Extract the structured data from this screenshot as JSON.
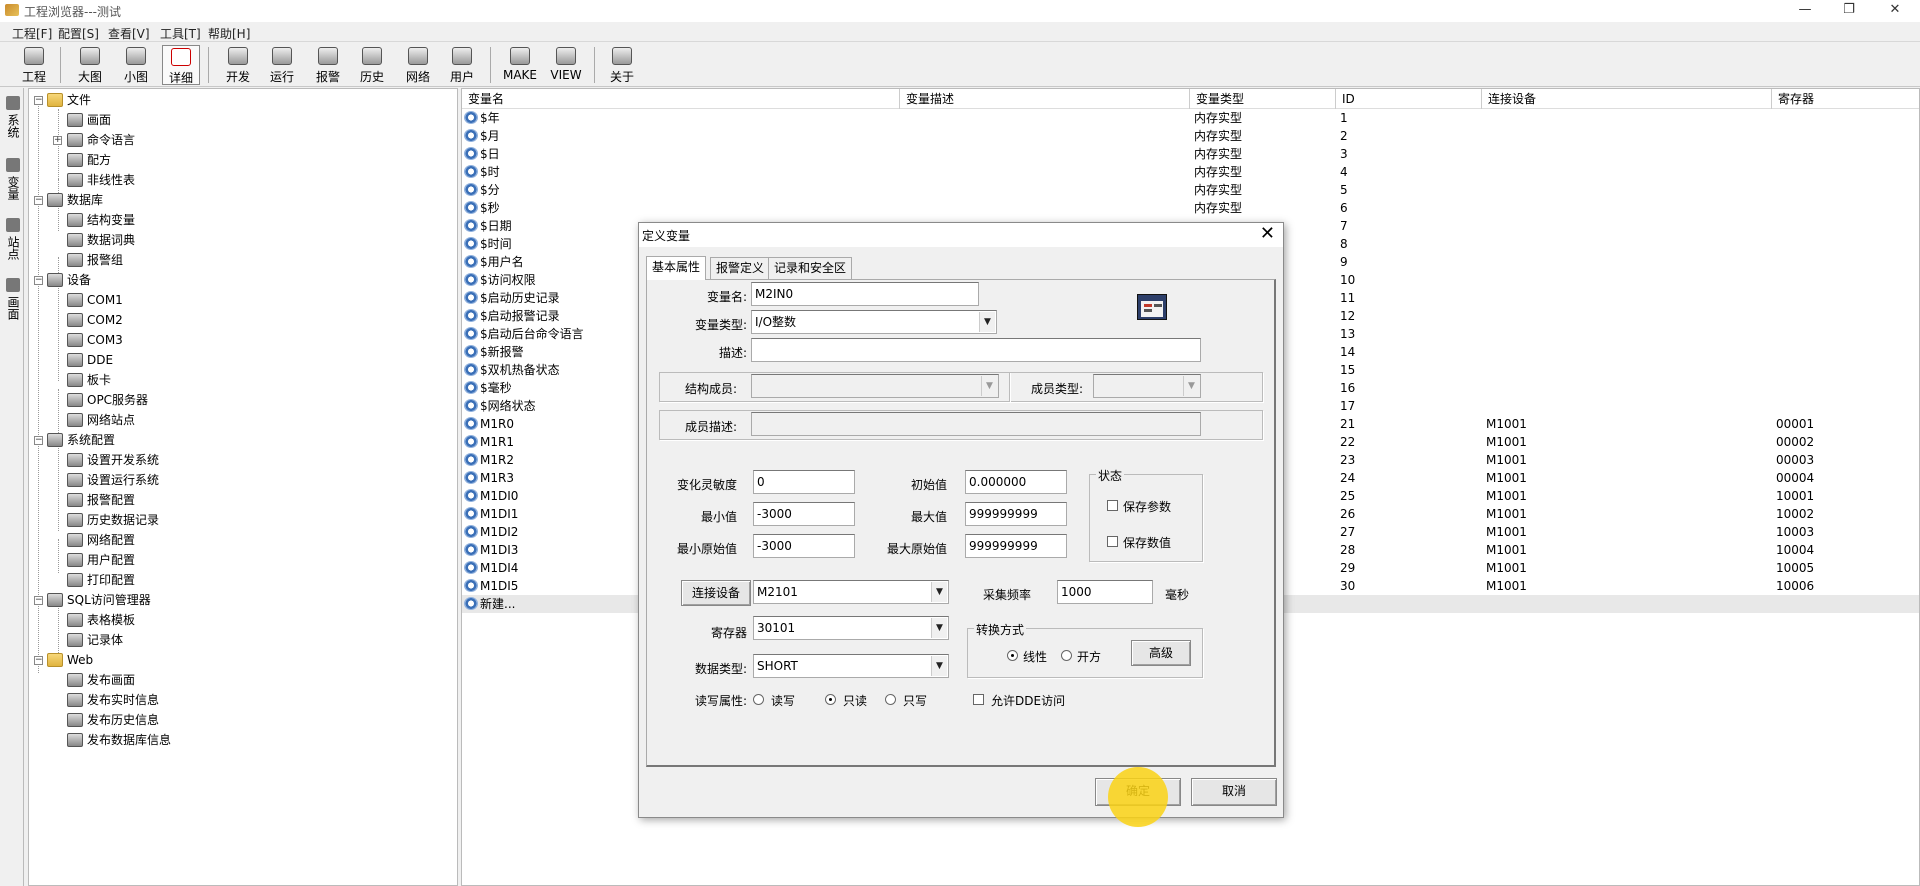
{
  "window": {
    "title": "工程浏览器---测试",
    "min": "—",
    "max": "❐",
    "close": "✕"
  },
  "menu": [
    "工程[F]",
    "配置[S]",
    "查看[V]",
    "工具[T]",
    "帮助[H]"
  ],
  "toolbar": [
    "工程",
    "大图",
    "小图",
    "详细",
    "开发",
    "运行",
    "报警",
    "历史",
    "网络",
    "用户",
    "MAKE",
    "VIEW",
    "关于"
  ],
  "vtabs": [
    "系统",
    "变量",
    "站点",
    "画面"
  ],
  "tree": {
    "file": "文件",
    "screen": "画面",
    "cmd": "命令语言",
    "recipe": "配方",
    "nonlinear": "非线性表",
    "db": "数据库",
    "struct": "结构变量",
    "dict": "数据词典",
    "alarmgroup": "报警组",
    "device": "设备",
    "com1": "COM1",
    "com2": "COM2",
    "com3": "COM3",
    "dde": "DDE",
    "board": "板卡",
    "opc": "OPC服务器",
    "netsite": "网络站点",
    "sysconf": "系统配置",
    "devsys": "设置开发系统",
    "runsys": "设置运行系统",
    "alarmconf": "报警配置",
    "histrec": "历史数据记录",
    "netconf": "网络配置",
    "userconf": "用户配置",
    "printconf": "打印配置",
    "sql": "SQL访问管理器",
    "tabletmpl": "表格模板",
    "recbody": "记录体",
    "web": "Web",
    "pubscreen": "发布画面",
    "pubrt": "发布实时信息",
    "pubhist": "发布历史信息",
    "pubdb": "发布数据库信息"
  },
  "list": {
    "headers": [
      "变量名",
      "变量描述",
      "变量类型",
      "ID",
      "连接设备",
      "寄存器"
    ],
    "rows": [
      [
        "$年",
        "",
        "内存实型",
        "1",
        "",
        ""
      ],
      [
        "$月",
        "",
        "内存实型",
        "2",
        "",
        ""
      ],
      [
        "$日",
        "",
        "内存实型",
        "3",
        "",
        ""
      ],
      [
        "$时",
        "",
        "内存实型",
        "4",
        "",
        ""
      ],
      [
        "$分",
        "",
        "内存实型",
        "5",
        "",
        ""
      ],
      [
        "$秒",
        "",
        "内存实型",
        "6",
        "",
        ""
      ],
      [
        "$日期",
        "",
        "",
        "7",
        "",
        ""
      ],
      [
        "$时间",
        "",
        "",
        "8",
        "",
        ""
      ],
      [
        "$用户名",
        "",
        "",
        "9",
        "",
        ""
      ],
      [
        "$访问权限",
        "",
        "",
        "10",
        "",
        ""
      ],
      [
        "$启动历史记录",
        "",
        "",
        "11",
        "",
        ""
      ],
      [
        "$启动报警记录",
        "",
        "",
        "12",
        "",
        ""
      ],
      [
        "$启动后台命令语言",
        "",
        "",
        "13",
        "",
        ""
      ],
      [
        "$新报警",
        "",
        "",
        "14",
        "",
        ""
      ],
      [
        "$双机热备状态",
        "",
        "",
        "15",
        "",
        ""
      ],
      [
        "$毫秒",
        "",
        "",
        "16",
        "",
        ""
      ],
      [
        "$网络状态",
        "",
        "",
        "17",
        "",
        ""
      ],
      [
        "M1R0",
        "",
        "",
        "21",
        "M1001",
        "00001"
      ],
      [
        "M1R1",
        "",
        "",
        "22",
        "M1001",
        "00002"
      ],
      [
        "M1R2",
        "",
        "",
        "23",
        "M1001",
        "00003"
      ],
      [
        "M1R3",
        "",
        "",
        "24",
        "M1001",
        "00004"
      ],
      [
        "M1DI0",
        "",
        "",
        "25",
        "M1001",
        "10001"
      ],
      [
        "M1DI1",
        "",
        "",
        "26",
        "M1001",
        "10002"
      ],
      [
        "M1DI2",
        "",
        "",
        "27",
        "M1001",
        "10003"
      ],
      [
        "M1DI3",
        "",
        "",
        "28",
        "M1001",
        "10004"
      ],
      [
        "M1DI4",
        "",
        "",
        "29",
        "M1001",
        "10005"
      ],
      [
        "M1DI5",
        "",
        "",
        "30",
        "M1001",
        "10006"
      ],
      [
        "新建...",
        "",
        "",
        "",
        "",
        ""
      ]
    ]
  },
  "dialog": {
    "title": "定义变量",
    "close": "✕",
    "tabs": [
      "基本属性",
      "报警定义",
      "记录和安全区"
    ],
    "labels": {
      "name": "变量名:",
      "type": "变量类型:",
      "desc": "描述:",
      "struct_member": "结构成员:",
      "member_type": "成员类型:",
      "member_desc": "成员描述:",
      "sensitivity": "变化灵敏度",
      "init": "初始值",
      "min": "最小值",
      "max": "最大值",
      "raw_min": "最小原始值",
      "raw_max": "最大原始值",
      "state": "状态",
      "save_param": "保存参数",
      "save_value": "保存数值",
      "freq": "采集频率",
      "ms": "毫秒",
      "register": "寄存器",
      "convert": "转换方式",
      "linear": "线性",
      "sqrt": "开方",
      "datatype": "数据类型:",
      "rw": "读写属性:",
      "read_write": "读写",
      "read_only": "只读",
      "write_only": "只写",
      "allow_dde": "允许DDE访问"
    },
    "values": {
      "name": "M2IN0",
      "type": "I/O整数",
      "desc": "",
      "sensitivity": "0",
      "init": "0.000000",
      "min": "-3000",
      "max": "999999999",
      "raw_min": "-3000",
      "raw_max": "999999999",
      "device": "M2101",
      "freq": "1000",
      "register": "30101",
      "datatype": "SHORT"
    },
    "buttons": {
      "connect": "连接设备",
      "advanced": "高级",
      "ok": "确定",
      "cancel": "取消"
    }
  }
}
